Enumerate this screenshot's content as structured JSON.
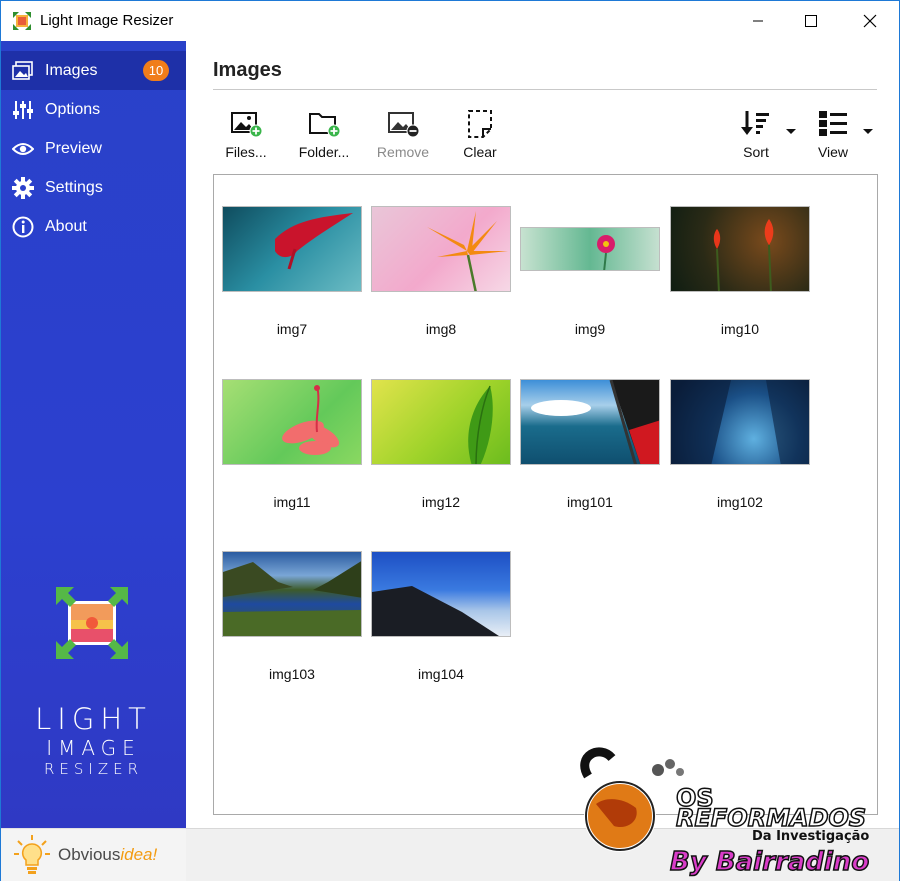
{
  "window": {
    "title": "Light Image Resizer"
  },
  "sidebar": {
    "items": [
      {
        "label": "Images",
        "icon": "images-icon",
        "badge": "10",
        "active": true
      },
      {
        "label": "Options",
        "icon": "sliders-icon"
      },
      {
        "label": "Preview",
        "icon": "eye-icon"
      },
      {
        "label": "Settings",
        "icon": "gear-icon"
      },
      {
        "label": "About",
        "icon": "info-icon"
      }
    ],
    "brand": {
      "line1": "LIGHT",
      "line2": "IMAGE",
      "line3": "RESIZER"
    },
    "footer": {
      "obvious": "Obvious",
      "idea": "idea!"
    }
  },
  "main": {
    "title": "Images",
    "toolbar": {
      "files": "Files...",
      "folder": "Folder...",
      "remove": "Remove",
      "clear": "Clear",
      "sort": "Sort",
      "view": "View"
    },
    "images": [
      {
        "name": "img7"
      },
      {
        "name": "img8"
      },
      {
        "name": "img9"
      },
      {
        "name": "img10"
      },
      {
        "name": "img11"
      },
      {
        "name": "img12"
      },
      {
        "name": "img101"
      },
      {
        "name": "img102"
      },
      {
        "name": "img103"
      },
      {
        "name": "img104"
      }
    ]
  },
  "watermark": {
    "line1": "OS",
    "line2": "REFORMADOS",
    "line3": "Da Investigação",
    "line4": "By Bairradino"
  },
  "colors": {
    "sidebar": "#2a3fcb",
    "sidebar_active": "#1e30a8",
    "badge": "#f07d1a",
    "accent_green": "#39b54a"
  }
}
